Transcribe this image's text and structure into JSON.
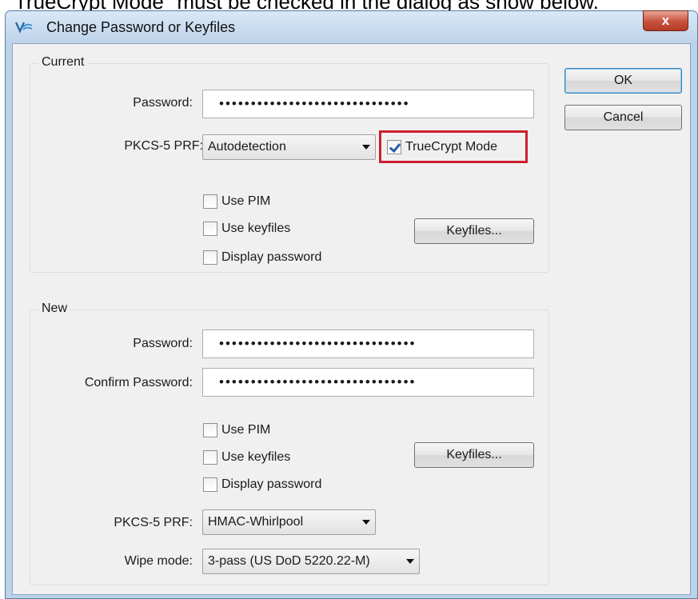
{
  "caption": "TrueCrypt Mode\" must be checked in the dialog as show below.",
  "window": {
    "title": "Change Password or Keyfiles",
    "close_label": "x"
  },
  "buttons": {
    "ok": "OK",
    "cancel": "Cancel"
  },
  "current": {
    "legend": "Current",
    "password_label": "Password:",
    "password_value": "••••••••••••••••••••••••••••••",
    "prf_label": "PKCS-5 PRF:",
    "prf_value": "Autodetection",
    "truecrypt_mode_label": "TrueCrypt Mode",
    "truecrypt_mode_checked": true,
    "use_pim_label": "Use PIM",
    "use_keyfiles_label": "Use keyfiles",
    "display_password_label": "Display password",
    "keyfiles_button": "Keyfiles..."
  },
  "new": {
    "legend": "New",
    "password_label": "Password:",
    "password_value": "•••••••••••••••••••••••••••••••",
    "confirm_label": "Confirm Password:",
    "confirm_value": "•••••••••••••••••••••••••••••••",
    "use_pim_label": "Use PIM",
    "use_keyfiles_label": "Use keyfiles",
    "display_password_label": "Display password",
    "keyfiles_button": "Keyfiles...",
    "prf_label": "PKCS-5 PRF:",
    "prf_value": "HMAC-Whirlpool",
    "wipe_label": "Wipe mode:",
    "wipe_value": "3-pass (US DoD 5220.22-M)"
  },
  "colors": {
    "highlight": "#cc1f2e",
    "titlebar": "#bed3ea",
    "close": "#c8503c"
  }
}
